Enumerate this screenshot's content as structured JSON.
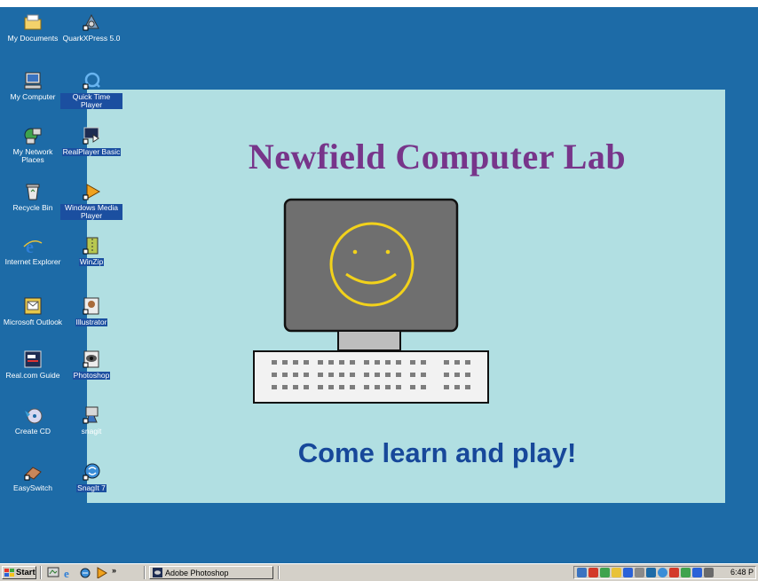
{
  "wallpaper": {
    "title": "Newfield Computer Lab",
    "subtitle": "Come learn and play!"
  },
  "desktop_icons": [
    {
      "label": "My Documents",
      "icon": "folder-icon"
    },
    {
      "label": "QuarkXPress 5.0",
      "icon": "quarkxpress-icon"
    },
    {
      "label": "My Computer",
      "icon": "computer-icon"
    },
    {
      "label": "Quick Time Player",
      "icon": "quicktime-icon"
    },
    {
      "label": "My Network Places",
      "icon": "network-icon"
    },
    {
      "label": "RealPlayer Basic",
      "icon": "realplayer-icon"
    },
    {
      "label": "Recycle Bin",
      "icon": "recycle-bin-icon"
    },
    {
      "label": "Windows Media Player",
      "icon": "media-player-icon"
    },
    {
      "label": "Internet Explorer",
      "icon": "internet-explorer-icon"
    },
    {
      "label": "WinZip",
      "icon": "winzip-icon"
    },
    {
      "label": "Microsoft Outlook",
      "icon": "outlook-icon"
    },
    {
      "label": "Illustrator",
      "icon": "illustrator-icon"
    },
    {
      "label": "Real.com Guide",
      "icon": "real-guide-icon"
    },
    {
      "label": "Photoshop",
      "icon": "photoshop-icon"
    },
    {
      "label": "Create CD",
      "icon": "create-cd-icon"
    },
    {
      "label": "snagit",
      "icon": "snagit-icon"
    },
    {
      "label": "EasySwitch",
      "icon": "easyswitch-icon"
    },
    {
      "label": "SnagIt 7",
      "icon": "snagit7-icon"
    }
  ],
  "taskbar": {
    "start_label": "Start",
    "quicklaunch_more": "»",
    "active_task": "Adobe Photoshop",
    "clock": "6:48 P"
  },
  "colors": {
    "desktop": "#1d6ba7",
    "wallpaper_panel": "#b1dfe2",
    "title_text": "#77358a",
    "subtitle_text": "#17489a",
    "smiley": "#f2d21b"
  }
}
